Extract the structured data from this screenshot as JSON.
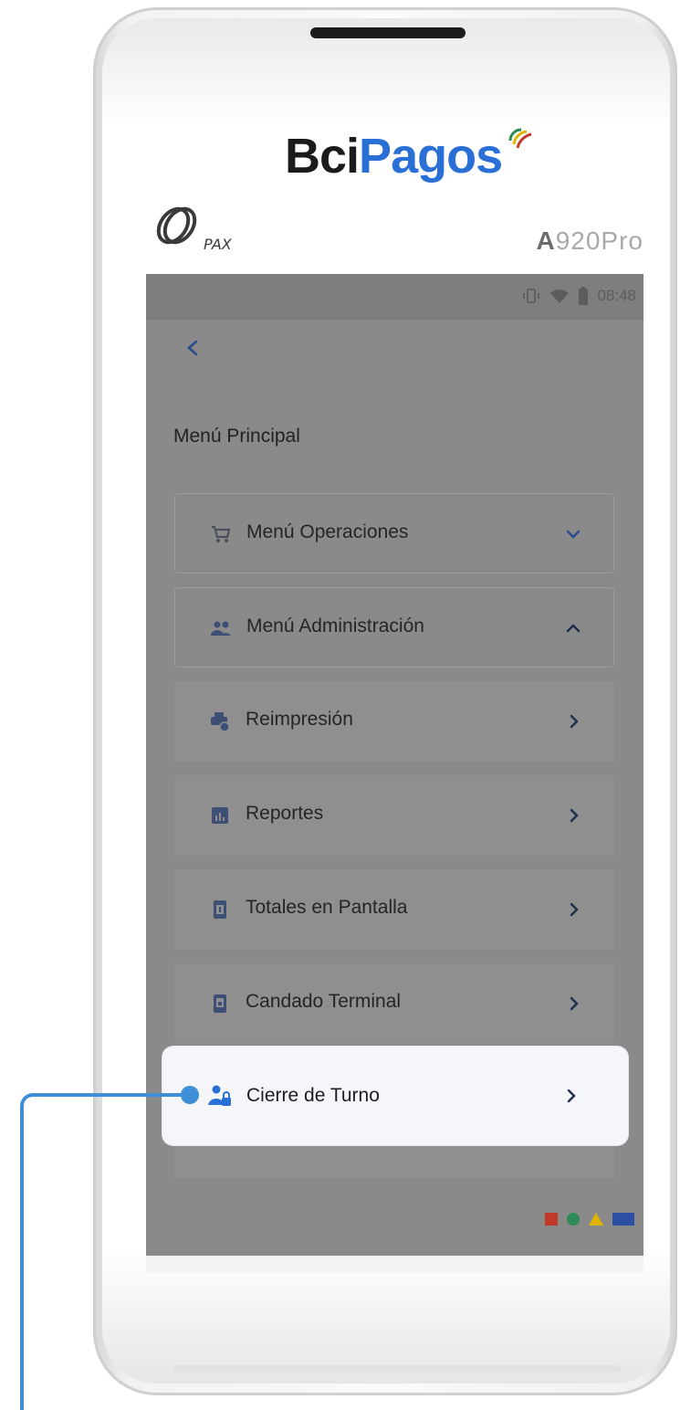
{
  "device": {
    "brand_part1": "Bci",
    "brand_part2": "Pagos",
    "maker_logo": "PAX",
    "model_prefix": "A",
    "model_suffix": "920Pro"
  },
  "statusbar": {
    "time": "08:48",
    "icons": [
      "vibrate-icon",
      "wifi-icon",
      "battery-icon"
    ]
  },
  "screen": {
    "back_icon": "chevron-left-icon",
    "title": "Menú Principal",
    "items": [
      {
        "label": "Menú Operaciones",
        "icon": "cart-icon",
        "chevron": "chevron-down-icon"
      },
      {
        "label": "Menú Administración",
        "icon": "users-icon",
        "chevron": "chevron-up-icon"
      },
      {
        "label": "Reimpresión",
        "icon": "printer-icon",
        "chevron": "chevron-right-icon"
      },
      {
        "label": "Reportes",
        "icon": "chart-icon",
        "chevron": "chevron-right-icon"
      },
      {
        "label": "Totales en Pantalla",
        "icon": "money-icon",
        "chevron": "chevron-right-icon"
      },
      {
        "label": "Candado Terminal",
        "icon": "lock-device-icon",
        "chevron": "chevron-right-icon"
      }
    ],
    "highlight": {
      "label": "Cierre de Turno",
      "icon": "user-lock-icon",
      "chevron": "chevron-right-icon"
    }
  },
  "colors": {
    "accent": "#2a6fd6",
    "callout": "#3f8fd8",
    "shape_red": "#c0392b",
    "shape_green": "#2e8b57",
    "shape_yellow": "#e0b400",
    "shape_blue": "#2c4fa3"
  }
}
